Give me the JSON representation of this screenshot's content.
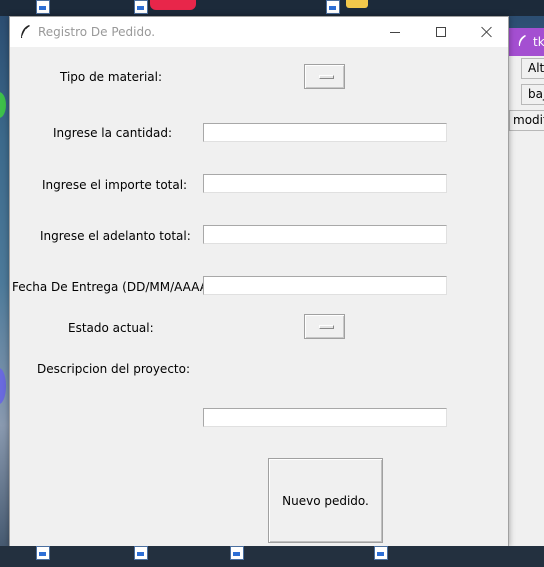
{
  "window": {
    "title": "Registro De Pedido."
  },
  "form": {
    "tipo_material_label": "Tipo de material:",
    "cantidad_label": "Ingrese la cantidad:",
    "cantidad_value": "",
    "importe_label": "Ingrese el importe total:",
    "importe_value": "",
    "adelanto_label": "Ingrese el adelanto total:",
    "adelanto_value": "",
    "fecha_label": "Fecha De Entrega (DD/MM/AAAA):",
    "fecha_value": "",
    "estado_label": "Estado actual:",
    "descripcion_label": "Descripcion del proyecto:",
    "descripcion_value": "",
    "submit_label": "Nuevo pedido."
  },
  "background_window": {
    "title": "tk",
    "buttons": [
      "Alta",
      "baja",
      "modif"
    ],
    "accent": "#a44fd1"
  },
  "icons": [
    "feather-icon",
    "minimize-icon",
    "maximize-icon",
    "close-icon",
    "option-menu-indicator-icon"
  ]
}
